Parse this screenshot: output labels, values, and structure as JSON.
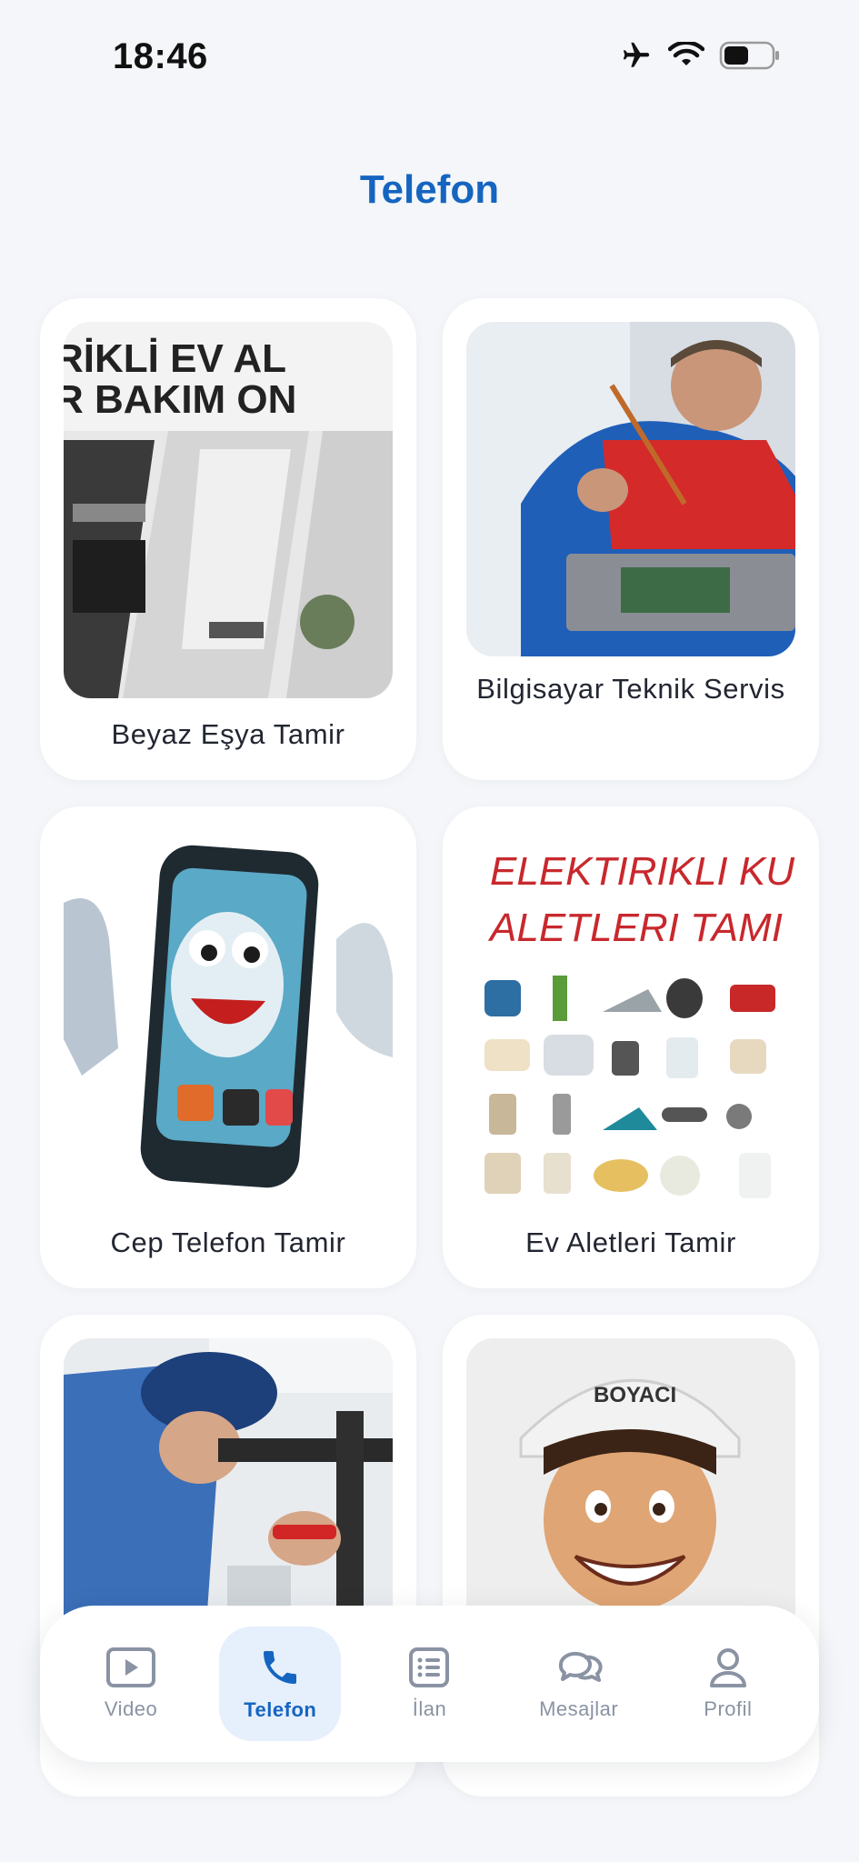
{
  "status_bar": {
    "time": "18:46"
  },
  "header": {
    "title": "Telefon"
  },
  "categories": [
    {
      "label": "Beyaz Eşya Tamir",
      "image_text": [
        "RİKLİ EV AL",
        "R BAKIM ON"
      ]
    },
    {
      "label": "Bilgisayar Teknik Servis"
    },
    {
      "label": "Cep Telefon Tamir"
    },
    {
      "label": "Ev Aletleri Tamir",
      "image_text": [
        "ELEKTIRIKLI KUC",
        "ALETLERI TAMI"
      ]
    },
    {
      "label": ""
    },
    {
      "label": "",
      "image_text": [
        "BOYACI"
      ]
    }
  ],
  "nav": {
    "items": [
      {
        "label": "Video",
        "icon": "video-icon"
      },
      {
        "label": "Telefon",
        "icon": "phone-icon",
        "active": true
      },
      {
        "label": "İlan",
        "icon": "list-icon"
      },
      {
        "label": "Mesajlar",
        "icon": "chat-icon"
      },
      {
        "label": "Profil",
        "icon": "user-icon"
      }
    ]
  },
  "colors": {
    "accent": "#1565c0",
    "active_bg": "#e6effc",
    "inactive": "#8a93a3",
    "background": "#f4f6f9"
  }
}
